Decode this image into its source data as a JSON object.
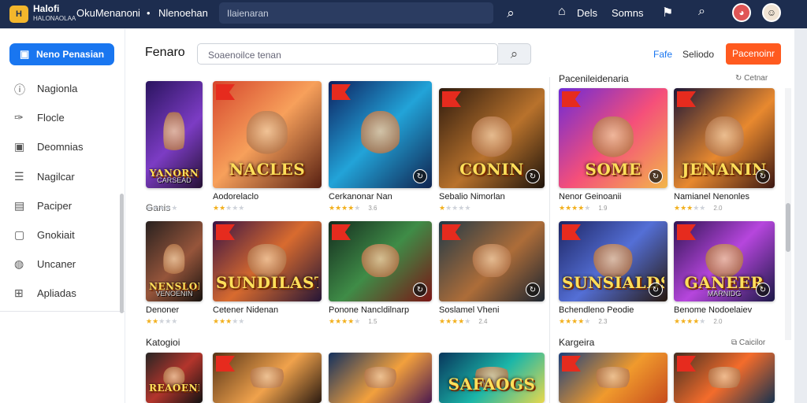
{
  "topbar": {
    "logo_text": "Halofi",
    "logo_subtext": "HALONAOLAA",
    "title": "OkuMenanoni",
    "separator": "•",
    "subtitle": "Nlenoehan",
    "search_placeholder": "Ilaienaran",
    "items": [
      "Dels",
      "Somns"
    ],
    "accent": "#1d2d4f"
  },
  "sidebar": {
    "primary_button": "Neno Penasian",
    "items": [
      {
        "label": "Nagionla",
        "icon": "info-icon"
      },
      {
        "label": "Flocle",
        "icon": "pin-icon"
      },
      {
        "label": "Deomnias",
        "icon": "camera-icon"
      },
      {
        "label": "Nagilcar",
        "icon": "list-icon"
      },
      {
        "label": "Paciper",
        "icon": "map-icon"
      },
      {
        "label": "Gnokiait",
        "icon": "chat-icon"
      },
      {
        "label": "Uncaner",
        "icon": "bag-icon"
      },
      {
        "label": "Apliadas",
        "icon": "apps-icon"
      }
    ],
    "primary_color": "#1976f0"
  },
  "main": {
    "page_title": "Fenaro",
    "search_placeholder": "Soaenoilce tenan",
    "link_primary": "Fafe",
    "link_secondary": "Seliodo",
    "orange_button": "Pacenoinr",
    "orange_color": "#ff5a1f",
    "right_top_header": "Pacenileidenaria",
    "right_top_action": "Cetnar",
    "left_mid_header": "Ganis",
    "left_bottom_header": "Katogioi",
    "right_bottom_header": "Kargeira",
    "right_bottom_action": "Caicilor"
  },
  "games": [
    {
      "art": "YANORN",
      "art_sub": "CARSEAD",
      "title": "",
      "rating": 0,
      "ratings": ""
    },
    {
      "art": "NACLES",
      "art_sub": "",
      "title": "Aodorelaclo",
      "rating": 2,
      "ratings": ""
    },
    {
      "art": "",
      "art_sub": "",
      "title": "Cerkanonar Nan",
      "rating": 4,
      "ratings": "3.6"
    },
    {
      "art": "CONIN",
      "art_sub": "",
      "title": "Sebalio Nimorlan",
      "rating": 1,
      "ratings": ""
    },
    {
      "art": "SOME",
      "art_sub": "",
      "title": "Nenor Geinoanii",
      "rating": 4,
      "ratings": "1.9"
    },
    {
      "art": "JENANIN",
      "art_sub": "",
      "title": "Namianel Nenonles",
      "rating": 3,
      "ratings": "2.0"
    },
    {
      "art": "NENSLOL",
      "art_sub": "VENOENIN",
      "title": "Denoner",
      "rating": 2,
      "ratings": ""
    },
    {
      "art": "SUNDILAST",
      "art_sub": "",
      "title": "Cetener Nidenan",
      "rating": 3,
      "ratings": ""
    },
    {
      "art": "",
      "art_sub": "",
      "title": "Ponone Nancldilnarp",
      "rating": 4,
      "ratings": "1.5"
    },
    {
      "art": "",
      "art_sub": "",
      "title": "Soslamel Vheni",
      "rating": 4,
      "ratings": "2.4"
    },
    {
      "art": "SUNSIALDS",
      "art_sub": "",
      "title": "Bchendleno Peodie",
      "rating": 4,
      "ratings": "2.3"
    },
    {
      "art": "GANEER",
      "art_sub": "MARNIDG",
      "title": "Benome Nodoelaiev",
      "rating": 4,
      "ratings": "2.0"
    },
    {
      "art": "REAOENN",
      "art_sub": "",
      "title": "",
      "rating": 0,
      "ratings": ""
    },
    {
      "art": "",
      "art_sub": "",
      "title": "",
      "rating": 0,
      "ratings": ""
    },
    {
      "art": "",
      "art_sub": "",
      "title": "",
      "rating": 0,
      "ratings": ""
    },
    {
      "art": "SAFAOGS",
      "art_sub": "",
      "title": "",
      "rating": 0,
      "ratings": ""
    },
    {
      "art": "",
      "art_sub": "",
      "title": "",
      "rating": 0,
      "ratings": ""
    },
    {
      "art": "",
      "art_sub": "",
      "title": "",
      "rating": 0,
      "ratings": ""
    }
  ]
}
